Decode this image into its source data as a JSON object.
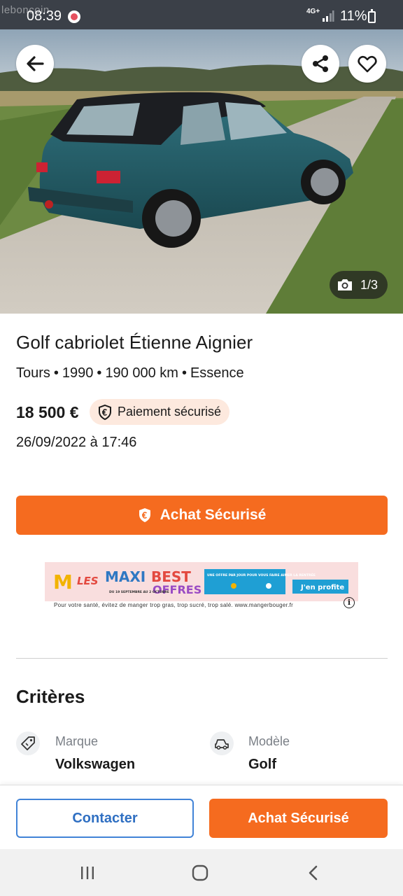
{
  "status_bar": {
    "watermark": "leboncoin",
    "time": "08:39",
    "network": "4G+",
    "battery": "11%"
  },
  "gallery": {
    "counter": "1/3",
    "back_icon": "arrow-left-icon",
    "share_icon": "share-icon",
    "favorite_icon": "heart-icon",
    "camera_icon": "camera-icon"
  },
  "ad": {
    "title": "Golf cabriolet Étienne Aignier",
    "location": "Tours",
    "year": "1990",
    "mileage": "190 000 km",
    "fuel": "Essence",
    "separator": "•",
    "price": "18 500 €",
    "secure_payment_label": "Paiement sécurisé",
    "date": "26/09/2022 à 17:46"
  },
  "cta": {
    "secure_purchase": "Achat Sécurisé"
  },
  "banner_ad": {
    "brand_logo": "M",
    "headline_part1": "LES",
    "headline_part2": "MAXI",
    "headline_part3": "BEST",
    "headline_part4": "OFFRES",
    "dates": "DU 19 SEPTEMBRE AU 2 OCTOBRE",
    "promo_text": "UNE OFFRE PAR JOUR POUR VOUS FAIRE AIMER LA RENTRÉE",
    "cta_label": "J'en profite",
    "disclaimer": "Pour votre santé, évitez de manger trop gras, trop sucré, trop salé. www.mangerbouger.fr",
    "info_label": "i"
  },
  "criteria": {
    "section_title": "Critères",
    "items": [
      {
        "label": "Marque",
        "value": "Volkswagen",
        "icon": "tag-icon"
      },
      {
        "label": "Modèle",
        "value": "Golf",
        "icon": "car-icon"
      }
    ]
  },
  "bottom_actions": {
    "contact": "Contacter",
    "buy": "Achat Sécurisé"
  },
  "colors": {
    "accent": "#f56b1f",
    "link_blue": "#4183d7",
    "pill_bg": "#fde9de"
  }
}
